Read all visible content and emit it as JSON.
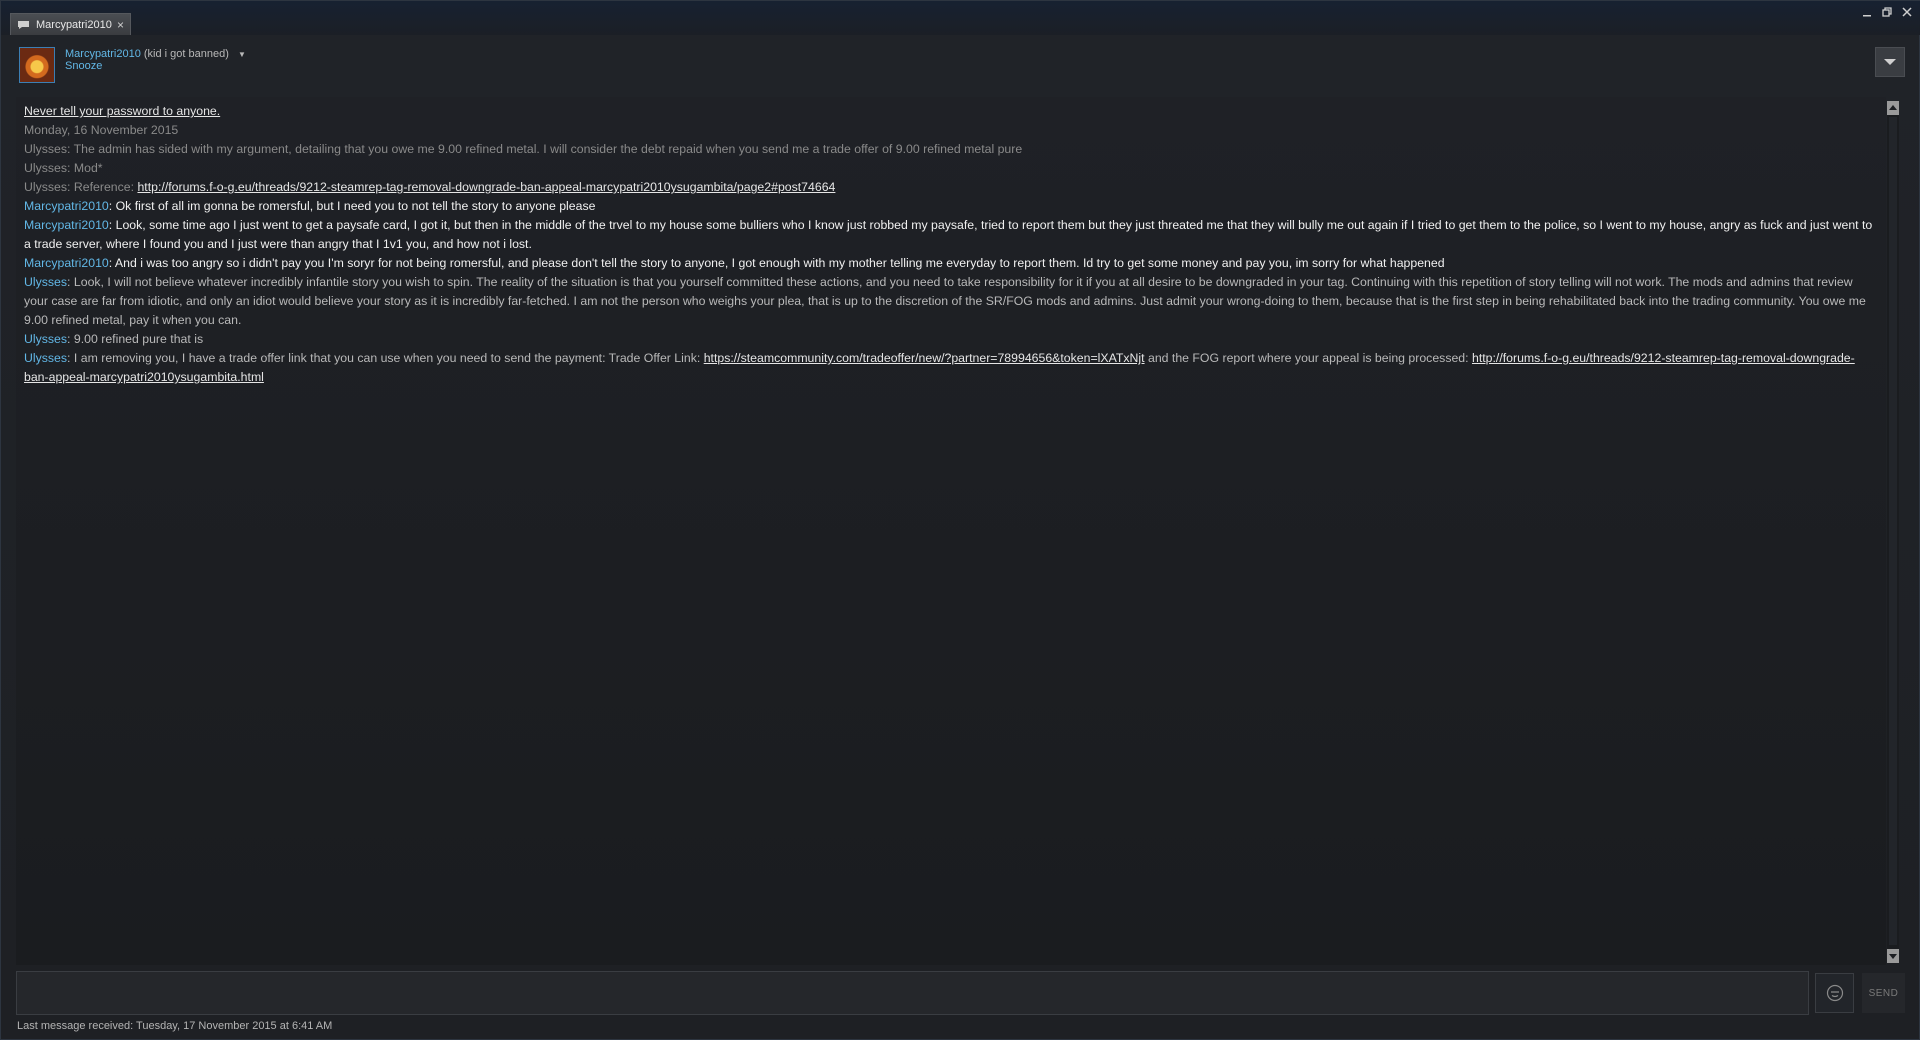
{
  "tab": {
    "title": "Marcypatri2010",
    "close_glyph": "×",
    "icon": "chat-bubble-icon"
  },
  "window_controls": [
    "minimize-icon",
    "restore-icon",
    "close-icon"
  ],
  "friend": {
    "name": "Marcypatri2010",
    "nickname": "(kid i got banned)",
    "status": "Snooze",
    "dropdown_glyph": "▼"
  },
  "messages": {
    "notice": "Never tell your password to anyone.",
    "date": "Monday, 16 November 2015",
    "m1": {
      "who": "Ulysses",
      "sep": ": ",
      "text": "The admin has sided with my argument, detailing that you owe me 9.00 refined metal. I will consider the debt repaid when you send me a trade offer of 9.00 refined metal pure"
    },
    "m2": {
      "who": "Ulysses",
      "sep": ": ",
      "text": "Mod*"
    },
    "m3": {
      "who": "Ulysses",
      "sep": ": ",
      "text": "Reference: ",
      "link": "http://forums.f-o-g.eu/threads/9212-steamrep-tag-removal-downgrade-ban-appeal-marcypatri2010ysugambita/page2#post74664"
    },
    "m4": {
      "who": "Marcypatri2010",
      "sep": ": ",
      "text": "Ok first of all im gonna be romersful, but I need you to not tell the story to anyone please"
    },
    "m5": {
      "who": "Marcypatri2010",
      "sep": ": ",
      "text": "Look, some time ago I just went to get a paysafe card, I got it, but then in the middle of the trvel to my house some bulliers who I know just robbed my paysafe, tried to report them but they just threated me that they will bully me out again if I tried to get them to the police, so I went to my house, angry as fuck and just went to a trade server, where I found you and I just were than angry that I 1v1 you, and how not i lost."
    },
    "m6": {
      "who": "Marcypatri2010",
      "sep": ": ",
      "text": "And i was too angry so i didn't pay you I'm soryr for not being romersful, and please don't tell the story to anyone, I got enough with my mother telling me everyday to report them. Id try to get some money and pay you, im sorry for what happened"
    },
    "m7": {
      "who": "Ulysses",
      "sep": ": ",
      "text": "Look, I will not believe whatever incredibly infantile story you wish to spin. The reality of the situation is that you yourself committed these actions, and you need to take responsibility for it if you at all desire to be downgraded in your tag. Continuing with this repetition of story telling will not work. The mods and admins that review your case are far from idiotic, and only an idiot would believe your story as it is incredibly far-fetched. I am not the person who weighs your plea, that is up to the discretion of the SR/FOG mods and admins. Just admit your wrong-doing to them, because that is the first step in being rehabilitated back into the trading community. You owe me 9.00 refined metal, pay it when you can."
    },
    "m8": {
      "who": "Ulysses",
      "sep": ": ",
      "text": "9.00 refined pure that is"
    },
    "m9": {
      "who": "Ulysses",
      "sep": ": ",
      "text": "I am removing you, I have a trade offer link that you can use when you need to send the payment: Trade Offer Link: ",
      "link1": "https://steamcommunity.com/tradeoffer/new/?partner=78994656&token=lXATxNjt",
      "text2": " and the FOG report where your appeal is being processed: ",
      "link2": "http://forums.f-o-g.eu/threads/9212-steamrep-tag-removal-downgrade-ban-appeal-marcypatri2010ysugambita.html"
    }
  },
  "input": {
    "placeholder": "",
    "value": ""
  },
  "send_label": "SEND",
  "footer": "Last message received: Tuesday, 17 November 2015 at 6:41 AM",
  "colors": {
    "name_blue": "#62b7e6",
    "bg": "#1d1f23",
    "text": "#c6c6c6"
  }
}
